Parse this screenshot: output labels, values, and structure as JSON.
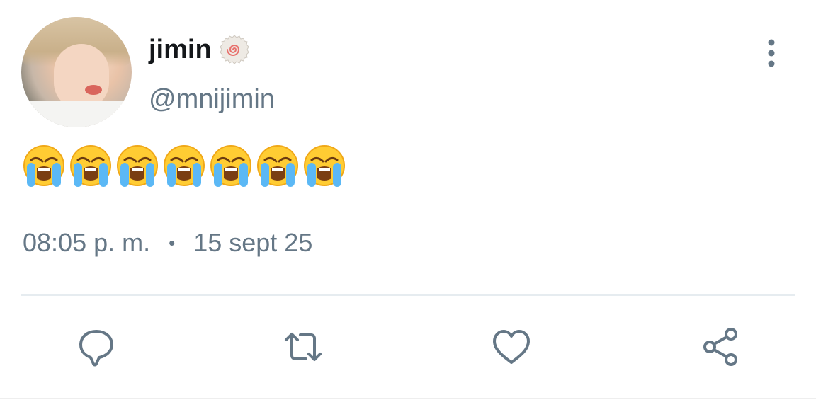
{
  "author": {
    "display_name": "jimin",
    "handle": "@mnijimin",
    "badge_icon": "narutomaki-icon"
  },
  "tweet": {
    "text": "😭😭😭😭😭😭😭",
    "emoji_icons": [
      "loudly-crying-face-icon",
      "loudly-crying-face-icon",
      "loudly-crying-face-icon",
      "loudly-crying-face-icon",
      "loudly-crying-face-icon",
      "loudly-crying-face-icon",
      "loudly-crying-face-icon"
    ]
  },
  "meta": {
    "time": "08:05 p. m.",
    "separator": "•",
    "date": "15 sept 25"
  },
  "actions": {
    "icons": [
      "reply-icon",
      "retweet-icon",
      "like-icon",
      "share-icon"
    ]
  },
  "colors": {
    "primary_text": "#14171a",
    "secondary_text": "#657786",
    "icon": "#657786",
    "divider": "#e6ecf0"
  }
}
